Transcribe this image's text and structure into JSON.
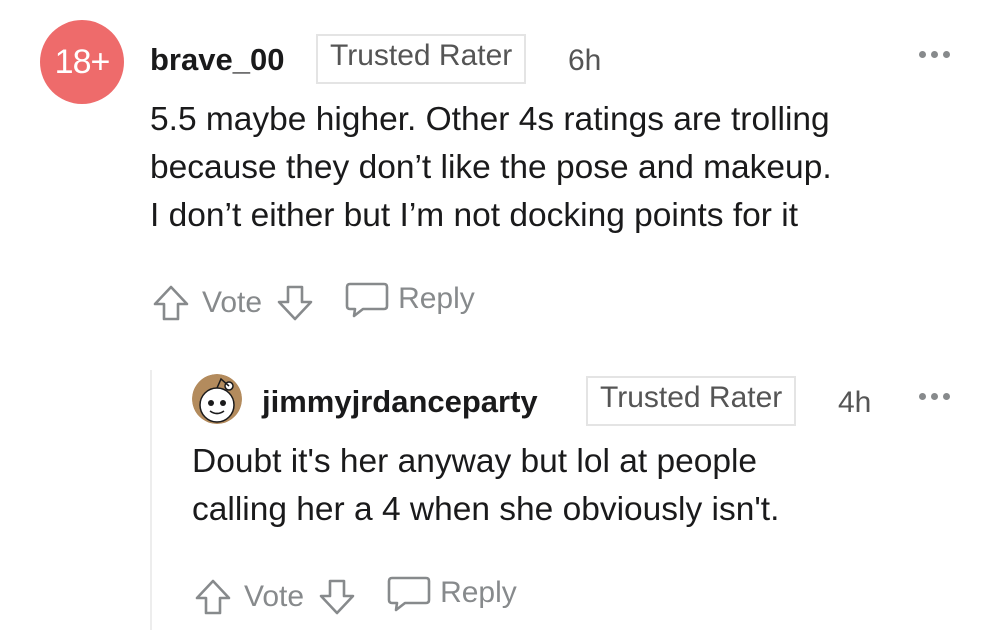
{
  "colors": {
    "badge": "#ee6b6b",
    "meta_gray": "#878a8c",
    "flair_border": "#e4e4e4",
    "thread_line": "#ededed"
  },
  "comments": [
    {
      "avatar": {
        "label": "18+"
      },
      "username": "brave_00",
      "flair": "Trusted Rater",
      "time": "6h",
      "body": [
        "5.5 maybe higher. Other 4s ratings are trolling",
        "because they don’t like the pose and makeup.",
        "I don’t either but I’m not docking points for it"
      ],
      "actions": {
        "vote": "Vote",
        "reply": "Reply"
      },
      "icons": [
        "upvote-icon",
        "downvote-icon",
        "reply-bubble-icon",
        "more-options-icon"
      ]
    },
    {
      "avatar": {
        "icon": "snoo-avatar-icon"
      },
      "username": "jimmyjrdanceparty",
      "flair": "Trusted Rater",
      "time": "4h",
      "body": [
        "Doubt it's her anyway but lol at people",
        "calling her a 4 when she obviously isn't."
      ],
      "actions": {
        "vote": "Vote",
        "reply": "Reply"
      },
      "icons": [
        "upvote-icon",
        "downvote-icon",
        "reply-bubble-icon",
        "more-options-icon"
      ]
    }
  ]
}
